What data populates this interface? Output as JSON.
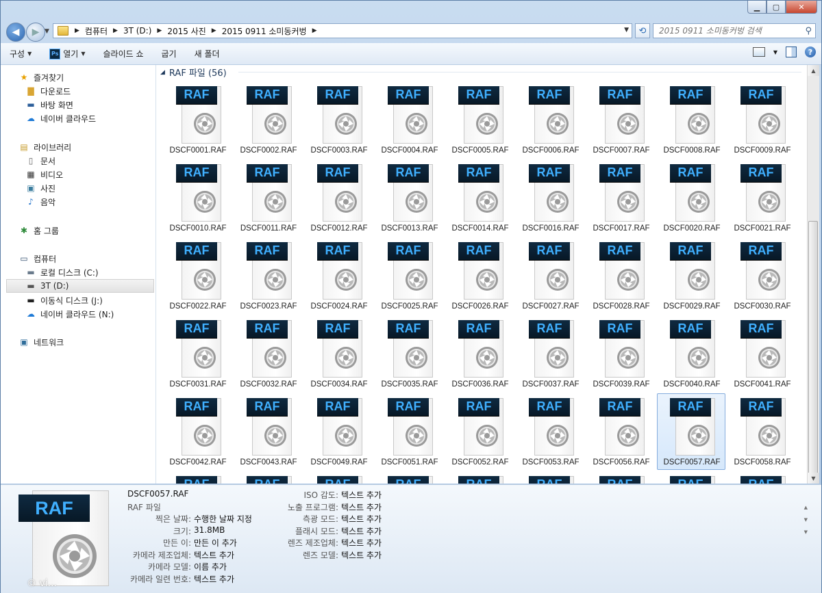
{
  "window": {
    "min": "▁",
    "max": "▢",
    "close": "✕"
  },
  "address": {
    "crumbs": [
      "컴퓨터",
      "3T (D:)",
      "2015 사진",
      "2015 0911 소미동커벙"
    ],
    "search_placeholder": "2015 0911 소미동커벙 검색"
  },
  "toolbar": {
    "organize": "구성",
    "open": "열기",
    "slideshow": "슬라이드 쇼",
    "burn": "굽기",
    "new_folder": "새 폴더"
  },
  "navpane": {
    "favorites": "즐겨찾기",
    "downloads": "다운로드",
    "desktop": "바탕 화면",
    "naver_cloud": "네이버 클라우드",
    "libraries": "라이브러리",
    "documents": "문서",
    "videos": "비디오",
    "pictures": "사진",
    "music": "음악",
    "homegroup": "홈 그룹",
    "computer": "컴퓨터",
    "local_disk": "로컬 디스크 (C:)",
    "drive_d": "3T (D:)",
    "removable": "이동식 디스크 (J:)",
    "naver_cloud_n": "네이버 클라우드 (N:)",
    "network": "네트워크"
  },
  "content": {
    "group_header": "RAF 파일 (56)",
    "badge": "RAF",
    "files": [
      "DSCF0001.RAF",
      "DSCF0002.RAF",
      "DSCF0003.RAF",
      "DSCF0004.RAF",
      "DSCF0005.RAF",
      "DSCF0006.RAF",
      "DSCF0007.RAF",
      "DSCF0008.RAF",
      "DSCF0009.RAF",
      "DSCF0010.RAF",
      "DSCF0011.RAF",
      "DSCF0012.RAF",
      "DSCF0013.RAF",
      "DSCF0014.RAF",
      "DSCF0016.RAF",
      "DSCF0017.RAF",
      "DSCF0020.RAF",
      "DSCF0021.RAF",
      "DSCF0022.RAF",
      "DSCF0023.RAF",
      "DSCF0024.RAF",
      "DSCF0025.RAF",
      "DSCF0026.RAF",
      "DSCF0027.RAF",
      "DSCF0028.RAF",
      "DSCF0029.RAF",
      "DSCF0030.RAF",
      "DSCF0031.RAF",
      "DSCF0032.RAF",
      "DSCF0034.RAF",
      "DSCF0035.RAF",
      "DSCF0036.RAF",
      "DSCF0037.RAF",
      "DSCF0039.RAF",
      "DSCF0040.RAF",
      "DSCF0041.RAF",
      "DSCF0042.RAF",
      "DSCF0043.RAF",
      "DSCF0049.RAF",
      "DSCF0051.RAF",
      "DSCF0052.RAF",
      "DSCF0053.RAF",
      "DSCF0056.RAF",
      "DSCF0057.RAF",
      "DSCF0058.RAF"
    ],
    "selected_file": "DSCF0057.RAF"
  },
  "details": {
    "name": "DSCF0057.RAF",
    "type": "RAF 파일",
    "left": [
      {
        "label": "찍은 날짜:",
        "value": "수행한 날짜 지정"
      },
      {
        "label": "크기:",
        "value": "31.8MB"
      },
      {
        "label": "만든 이:",
        "value": "만든 이 추가"
      },
      {
        "label": "카메라 제조업체:",
        "value": "텍스트 추가"
      },
      {
        "label": "카메라 모델:",
        "value": "이름 추가"
      },
      {
        "label": "카메라 일련 번호:",
        "value": "텍스트 추가"
      }
    ],
    "right": [
      {
        "label": "ISO 감도:",
        "value": "텍스트 추가"
      },
      {
        "label": "노출 프로그램:",
        "value": "텍스트 추가"
      },
      {
        "label": "측광 모드:",
        "value": "텍스트 추가"
      },
      {
        "label": "플래시 모드:",
        "value": "텍스트 추가"
      },
      {
        "label": "렌즈 제조업체:",
        "value": "텍스트 추가"
      },
      {
        "label": "렌즈 모델:",
        "value": "텍스트 추가"
      }
    ],
    "watermark": "© vi..."
  },
  "colors": {
    "accent": "#1e395b",
    "badge_text": "#40b0ff",
    "selection": "#d6e8fb"
  }
}
